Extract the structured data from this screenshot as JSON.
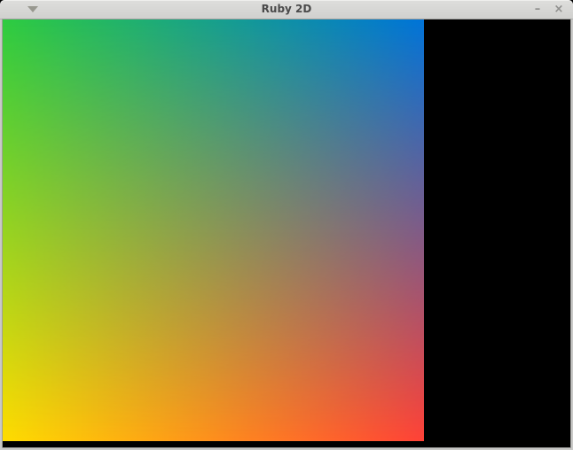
{
  "window": {
    "title": "Ruby 2D",
    "controls": {
      "menu_icon": "triangle-down",
      "minimize_label": "–",
      "close_label": "×"
    }
  },
  "canvas": {
    "background_color": "#000000",
    "quad": {
      "top_left_color": "#2ECC40",
      "top_right_color": "#0074D9",
      "bottom_left_color": "#FFDC00",
      "bottom_right_color": "#FF4136"
    }
  }
}
